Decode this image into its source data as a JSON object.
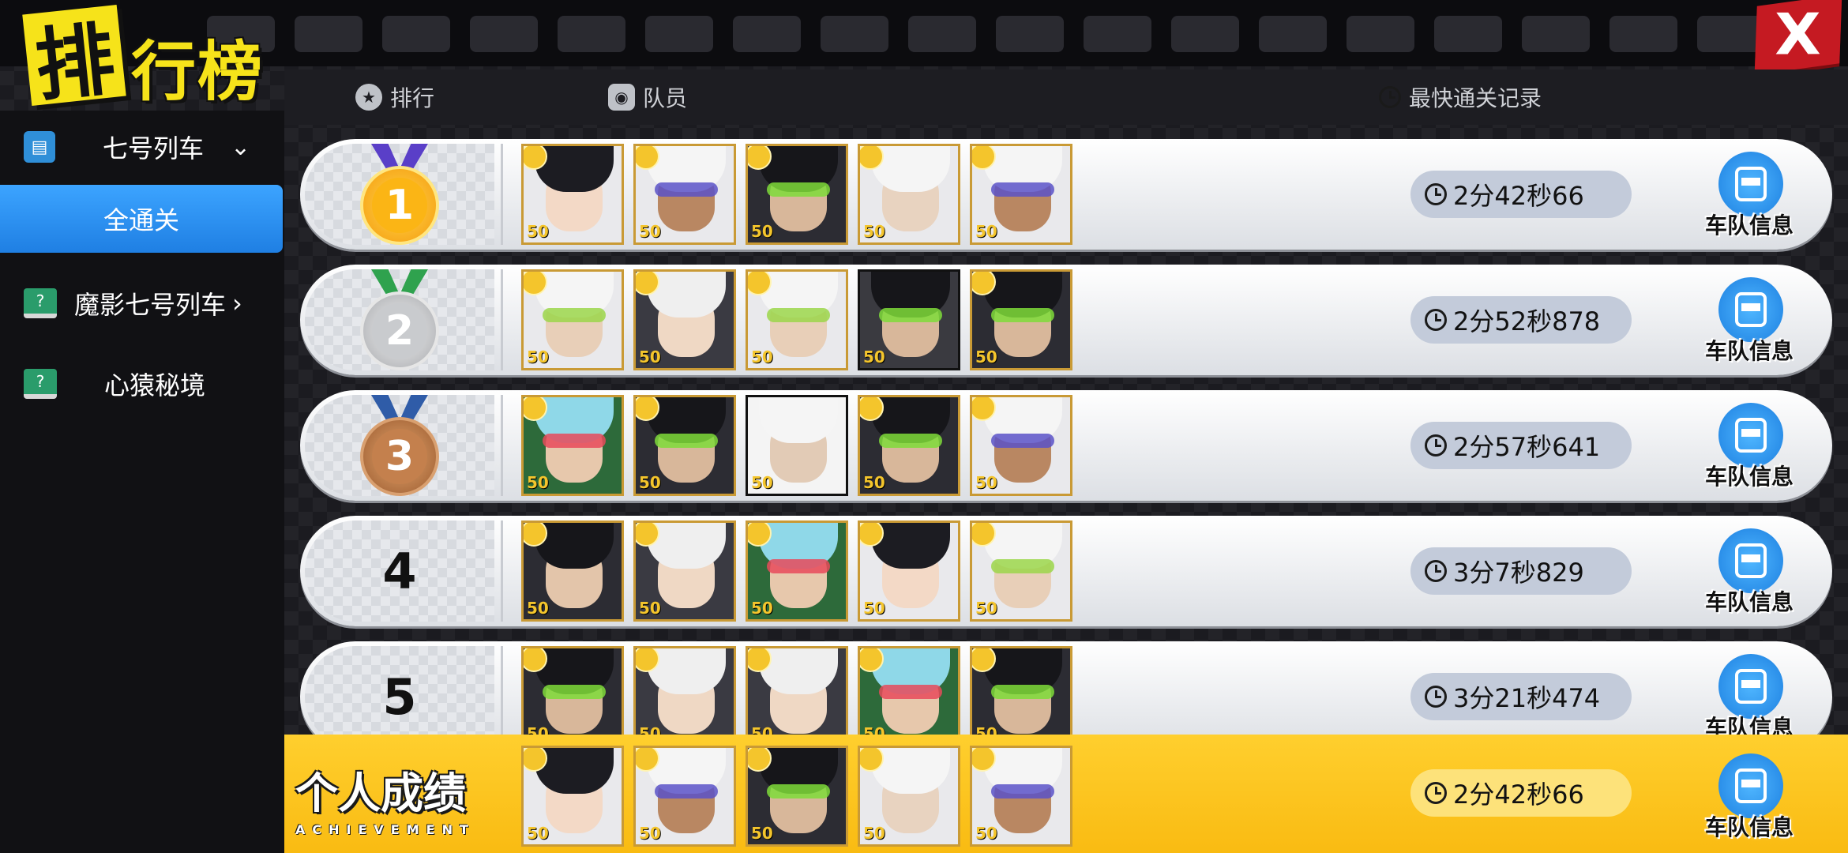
{
  "header": {
    "logo_char": "排",
    "logo_rest": "行榜",
    "close_label": "X"
  },
  "tabs": [
    {
      "label": "排行",
      "icon": "star-badge-icon"
    },
    {
      "label": "队员",
      "icon": "robot-face-icon"
    },
    {
      "label": "最快通关记录",
      "icon": "clock-icon"
    }
  ],
  "sidebar": {
    "train_select": {
      "label": "七号列车",
      "icon": "train-icon"
    },
    "active_item": "全通关",
    "items": [
      {
        "label": "魔影七号列车",
        "icon": "computer-icon",
        "has_arrow": true
      },
      {
        "label": "心猿秘境",
        "icon": "computer-icon",
        "has_arrow": false
      }
    ]
  },
  "rankings": [
    {
      "rank": "1",
      "medal": "gold",
      "time": "2分42秒66",
      "team_label": "车队信息",
      "members": [
        {
          "level": "50",
          "style": "panda-girl"
        },
        {
          "level": "50",
          "style": "panda-visor"
        },
        {
          "level": "50",
          "style": "dark-green"
        },
        {
          "level": "50",
          "style": "panda-scar"
        },
        {
          "level": "50",
          "style": "panda-visor"
        }
      ]
    },
    {
      "rank": "2",
      "medal": "silver",
      "time": "2分52秒878",
      "team_label": "车队信息",
      "members": [
        {
          "level": "50",
          "style": "panda-green"
        },
        {
          "level": "50",
          "style": "white-hair"
        },
        {
          "level": "50",
          "style": "panda-green"
        },
        {
          "level": "50",
          "style": "dark-green-plain"
        },
        {
          "level": "50",
          "style": "dark-green"
        }
      ]
    },
    {
      "rank": "3",
      "medal": "bronze",
      "time": "2分57秒641",
      "team_label": "车队信息",
      "members": [
        {
          "level": "50",
          "style": "cyan-hair"
        },
        {
          "level": "50",
          "style": "dark-green"
        },
        {
          "level": "50",
          "style": "panda-plain"
        },
        {
          "level": "50",
          "style": "dark-green"
        },
        {
          "level": "50",
          "style": "panda-visor"
        }
      ]
    },
    {
      "rank": "4",
      "medal": "none",
      "time": "3分7秒829",
      "team_label": "车队信息",
      "members": [
        {
          "level": "50",
          "style": "dark-hair"
        },
        {
          "level": "50",
          "style": "white-hair"
        },
        {
          "level": "50",
          "style": "cyan-hair"
        },
        {
          "level": "50",
          "style": "panda-girl"
        },
        {
          "level": "50",
          "style": "panda-green"
        }
      ]
    },
    {
      "rank": "5",
      "medal": "none",
      "time": "3分21秒474",
      "team_label": "车队信息",
      "members": [
        {
          "level": "50",
          "style": "dark-green"
        },
        {
          "level": "50",
          "style": "white-hair"
        },
        {
          "level": "50",
          "style": "white-hair"
        },
        {
          "level": "50",
          "style": "cyan-hair"
        },
        {
          "level": "50",
          "style": "dark-green"
        }
      ]
    }
  ],
  "personal": {
    "title": "个人成绩",
    "subtitle": "ACHIEVEMENT",
    "time": "2分42秒66",
    "team_label": "车队信息",
    "members": [
      {
        "level": "50",
        "style": "panda-girl"
      },
      {
        "level": "50",
        "style": "panda-visor"
      },
      {
        "level": "50",
        "style": "dark-green"
      },
      {
        "level": "50",
        "style": "panda-scar"
      },
      {
        "level": "50",
        "style": "panda-visor"
      }
    ]
  },
  "colors": {
    "accent_blue": "#1f7fe3",
    "logo_yellow": "#f6e31a",
    "close_red": "#c51a22",
    "personal_bar": "#f9bb12"
  }
}
